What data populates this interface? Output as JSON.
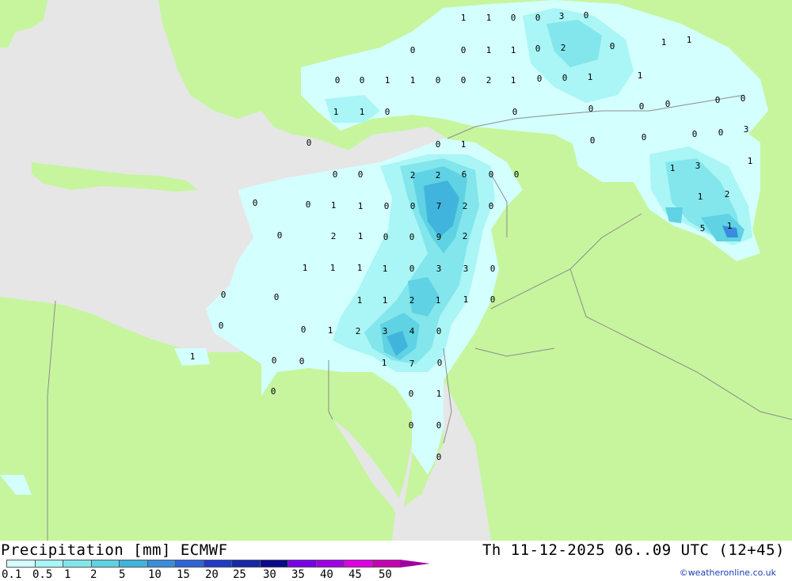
{
  "header": {
    "title_left": "Precipitation [mm] ECMWF",
    "title_right": "Th 11-12-2025 06..09 UTC (12+45)"
  },
  "legend": {
    "ticks": [
      "0.1",
      "0.5",
      "1",
      "2",
      "5",
      "10",
      "15",
      "20",
      "25",
      "30",
      "35",
      "40",
      "45",
      "50"
    ],
    "colors": [
      "#d4ffff",
      "#aaf5f5",
      "#82e6ec",
      "#5fd2e3",
      "#40b4dc",
      "#3a8cdc",
      "#2f64d8",
      "#1e3cc8",
      "#1428a8",
      "#0a0a8c",
      "#7800e6",
      "#a000e6",
      "#e000e6",
      "#c800b4"
    ],
    "arrow_color": "#a000a0"
  },
  "credit": "©weatheronline.co.uk",
  "map": {
    "land_color": "#c6f59e",
    "sea_color": "#e6e6e6",
    "border_color": "#8c8c8c",
    "labels": [
      {
        "t": "1"
      },
      {
        "t": "1"
      },
      {
        "t": "0"
      },
      {
        "t": "0"
      },
      {
        "t": "3"
      },
      {
        "t": "0"
      },
      {
        "t": "0"
      },
      {
        "t": "0"
      },
      {
        "t": "1"
      },
      {
        "t": "1"
      },
      {
        "t": "0"
      },
      {
        "t": "2"
      },
      {
        "t": "0"
      },
      {
        "t": "1"
      },
      {
        "t": "1"
      },
      {
        "t": "0"
      },
      {
        "t": "0"
      },
      {
        "t": "1"
      },
      {
        "t": "1"
      },
      {
        "t": "0"
      },
      {
        "t": "0"
      },
      {
        "t": "2"
      },
      {
        "t": "1"
      },
      {
        "t": "0"
      },
      {
        "t": "0"
      },
      {
        "t": "1"
      },
      {
        "t": "1"
      },
      {
        "t": "1"
      },
      {
        "t": "1"
      },
      {
        "t": "0"
      },
      {
        "t": "0"
      },
      {
        "t": "0"
      },
      {
        "t": "0"
      },
      {
        "t": "0"
      },
      {
        "t": "0"
      },
      {
        "t": "0"
      },
      {
        "t": "0"
      },
      {
        "t": "0"
      },
      {
        "t": "1"
      },
      {
        "t": "0"
      },
      {
        "t": "3"
      },
      {
        "t": "0"
      },
      {
        "t": "0"
      },
      {
        "t": "0"
      },
      {
        "t": "0"
      },
      {
        "t": "0"
      },
      {
        "t": "2"
      },
      {
        "t": "2"
      },
      {
        "t": "6"
      },
      {
        "t": "0"
      },
      {
        "t": "0"
      },
      {
        "t": "0"
      },
      {
        "t": "0"
      },
      {
        "t": "1"
      },
      {
        "t": "1"
      },
      {
        "t": "0"
      },
      {
        "t": "0"
      },
      {
        "t": "7"
      },
      {
        "t": "2"
      },
      {
        "t": "0"
      },
      {
        "t": "0"
      },
      {
        "t": "2"
      },
      {
        "t": "1"
      },
      {
        "t": "0"
      },
      {
        "t": "0"
      },
      {
        "t": "9"
      },
      {
        "t": "2"
      },
      {
        "t": "1"
      },
      {
        "t": "1"
      },
      {
        "t": "1"
      },
      {
        "t": "1"
      },
      {
        "t": "0"
      },
      {
        "t": "3"
      },
      {
        "t": "3"
      },
      {
        "t": "0"
      },
      {
        "t": "0"
      },
      {
        "t": "0"
      },
      {
        "t": "1"
      },
      {
        "t": "1"
      },
      {
        "t": "2"
      },
      {
        "t": "1"
      },
      {
        "t": "1"
      },
      {
        "t": "0"
      },
      {
        "t": "0"
      },
      {
        "t": "0"
      },
      {
        "t": "1"
      },
      {
        "t": "2"
      },
      {
        "t": "3"
      },
      {
        "t": "4"
      },
      {
        "t": "0"
      },
      {
        "t": "1"
      },
      {
        "t": "0"
      },
      {
        "t": "0"
      },
      {
        "t": "1"
      },
      {
        "t": "7"
      },
      {
        "t": "0"
      },
      {
        "t": "0"
      },
      {
        "t": "0"
      },
      {
        "t": "1"
      },
      {
        "t": "0"
      },
      {
        "t": "0"
      },
      {
        "t": "0"
      },
      {
        "t": "1"
      },
      {
        "t": "3"
      },
      {
        "t": "1"
      },
      {
        "t": "1"
      },
      {
        "t": "2"
      },
      {
        "t": "5"
      },
      {
        "t": "1"
      }
    ]
  }
}
